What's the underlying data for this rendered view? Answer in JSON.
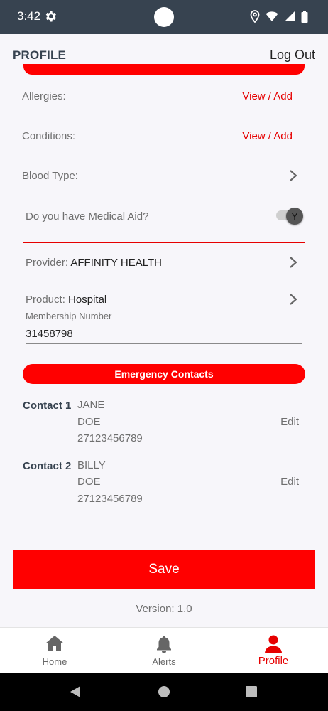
{
  "status_bar": {
    "time": "3:42"
  },
  "header": {
    "title": "PROFILE",
    "logout_label": "Log Out"
  },
  "medical": {
    "allergies_label": "Allergies:",
    "allergies_action": "View / Add",
    "conditions_label": "Conditions:",
    "conditions_action": "View / Add",
    "blood_type_label": "Blood Type:",
    "medical_aid_question": "Do you have Medical Aid?",
    "medical_aid_toggle": "Y",
    "provider_label": "Provider:",
    "provider_value": "AFFINITY HEALTH",
    "product_label": "Product:",
    "product_value": "Hospital",
    "membership_label": "Membership Number",
    "membership_value": "31458798"
  },
  "emergency": {
    "title": "Emergency Contacts",
    "contacts": [
      {
        "label": "Contact 1",
        "first_name": "JANE",
        "last_name": "DOE",
        "phone": "27123456789",
        "edit_label": "Edit"
      },
      {
        "label": "Contact 2",
        "first_name": "BILLY",
        "last_name": "DOE",
        "phone": "27123456789",
        "edit_label": "Edit"
      }
    ]
  },
  "actions": {
    "save_label": "Save"
  },
  "footer": {
    "version": "Version: 1.0"
  },
  "bottom_nav": {
    "items": [
      {
        "label": "Home",
        "icon": "home-icon"
      },
      {
        "label": "Alerts",
        "icon": "bell-icon"
      },
      {
        "label": "Profile",
        "icon": "person-icon",
        "active": true
      }
    ]
  },
  "colors": {
    "accent": "#ff0000",
    "header_bg": "#374350",
    "text_muted": "#6f6f6f"
  }
}
